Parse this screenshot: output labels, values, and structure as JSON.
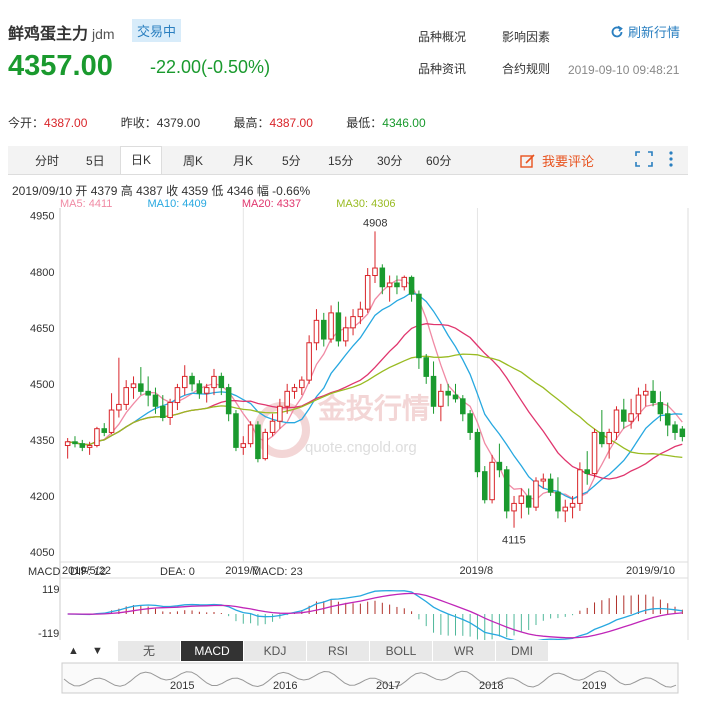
{
  "header": {
    "name": "鲜鸡蛋主力",
    "code": "jdm",
    "status": "交易中",
    "price": "4357.00",
    "change": "-22.00(-0.50%)",
    "links": [
      "品种概况",
      "影响因素",
      "品种资讯",
      "合约规则"
    ],
    "refresh": "刷新行情",
    "timestamp": "2019-09-10 09:48:21"
  },
  "stats": {
    "open_label": "今开：",
    "open": "4387.00",
    "prev_label": "昨收：",
    "prev": "4379.00",
    "high_label": "最高：",
    "high": "4387.00",
    "low_label": "最低：",
    "low": "4346.00"
  },
  "tabs": [
    "分时",
    "5日",
    "日K",
    "周K",
    "月K",
    "5分",
    "15分",
    "30分",
    "60分"
  ],
  "active_tab": "日K",
  "review": "我要评论",
  "ohlc_line": "2019/09/10  开 4379  高 4387  收 4359  低 4346  幅 -0.66%",
  "ma": [
    {
      "label": "MA5: 4411",
      "color": "#f08aa4"
    },
    {
      "label": "MA10: 4409",
      "color": "#27a8e0"
    },
    {
      "label": "MA20: 4337",
      "color": "#e0366e"
    },
    {
      "label": "MA30: 4306",
      "color": "#99bb22"
    }
  ],
  "macd_line": {
    "title": "MACD",
    "dif": "DIF: 12",
    "dea": "DEA: 0",
    "macd": "MACD: 23"
  },
  "indicator_buttons": [
    "无",
    "MACD",
    "KDJ",
    "RSI",
    "BOLL",
    "WR",
    "DMI"
  ],
  "active_indicator": "MACD",
  "nav_years": [
    "2015",
    "2016",
    "2017",
    "2018",
    "2019"
  ],
  "watermark": {
    "brand": "金投行情",
    "url": "quote.cngold.org"
  },
  "colors": {
    "up": "#d9252a",
    "down": "#1a9a2e",
    "accent": "#2a7fc0"
  },
  "chart_data": {
    "type": "candlestick",
    "title": "",
    "price_axis": {
      "ticks": [
        4950,
        4800,
        4650,
        4500,
        4350,
        4200,
        4050
      ],
      "ylim": [
        4050,
        4960
      ]
    },
    "date_labels": [
      "2019/5/22",
      "2019/7",
      "2019/8",
      "2019/9/10"
    ],
    "annotations": {
      "max": 4908,
      "min": 4115
    },
    "candles": [
      [
        4335,
        4355,
        4300,
        4345
      ],
      [
        4345,
        4360,
        4330,
        4340
      ],
      [
        4340,
        4350,
        4320,
        4330
      ],
      [
        4330,
        4345,
        4310,
        4335
      ],
      [
        4335,
        4385,
        4330,
        4380
      ],
      [
        4380,
        4395,
        4360,
        4370
      ],
      [
        4370,
        4475,
        4365,
        4430
      ],
      [
        4430,
        4570,
        4410,
        4445
      ],
      [
        4445,
        4510,
        4430,
        4490
      ],
      [
        4490,
        4520,
        4460,
        4500
      ],
      [
        4500,
        4545,
        4470,
        4480
      ],
      [
        4480,
        4520,
        4440,
        4470
      ],
      [
        4470,
        4490,
        4420,
        4440
      ],
      [
        4440,
        4470,
        4400,
        4410
      ],
      [
        4410,
        4460,
        4390,
        4450
      ],
      [
        4450,
        4500,
        4430,
        4490
      ],
      [
        4490,
        4550,
        4470,
        4520
      ],
      [
        4520,
        4530,
        4480,
        4500
      ],
      [
        4500,
        4510,
        4460,
        4475
      ],
      [
        4475,
        4500,
        4450,
        4490
      ],
      [
        4490,
        4540,
        4470,
        4520
      ],
      [
        4520,
        4530,
        4470,
        4490
      ],
      [
        4490,
        4500,
        4400,
        4420
      ],
      [
        4420,
        4430,
        4320,
        4330
      ],
      [
        4330,
        4360,
        4310,
        4340
      ],
      [
        4340,
        4400,
        4330,
        4390
      ],
      [
        4390,
        4400,
        4290,
        4300
      ],
      [
        4300,
        4380,
        4295,
        4370
      ],
      [
        4370,
        4420,
        4360,
        4400
      ],
      [
        4400,
        4460,
        4380,
        4440
      ],
      [
        4440,
        4500,
        4420,
        4480
      ],
      [
        4480,
        4500,
        4460,
        4490
      ],
      [
        4490,
        4520,
        4470,
        4510
      ],
      [
        4510,
        4630,
        4500,
        4610
      ],
      [
        4610,
        4700,
        4590,
        4670
      ],
      [
        4670,
        4690,
        4600,
        4620
      ],
      [
        4620,
        4710,
        4610,
        4690
      ],
      [
        4690,
        4720,
        4600,
        4615
      ],
      [
        4615,
        4680,
        4600,
        4650
      ],
      [
        4650,
        4700,
        4630,
        4680
      ],
      [
        4680,
        4720,
        4660,
        4700
      ],
      [
        4700,
        4810,
        4690,
        4790
      ],
      [
        4790,
        4908,
        4770,
        4810
      ],
      [
        4810,
        4820,
        4740,
        4760
      ],
      [
        4760,
        4790,
        4720,
        4770
      ],
      [
        4770,
        4790,
        4740,
        4760
      ],
      [
        4760,
        4790,
        4750,
        4785
      ],
      [
        4785,
        4790,
        4720,
        4740
      ],
      [
        4740,
        4750,
        4540,
        4570
      ],
      [
        4570,
        4580,
        4500,
        4520
      ],
      [
        4520,
        4560,
        4420,
        4440
      ],
      [
        4440,
        4500,
        4400,
        4480
      ],
      [
        4480,
        4500,
        4440,
        4470
      ],
      [
        4470,
        4500,
        4450,
        4460
      ],
      [
        4460,
        4470,
        4400,
        4420
      ],
      [
        4420,
        4430,
        4350,
        4370
      ],
      [
        4370,
        4380,
        4250,
        4265
      ],
      [
        4265,
        4280,
        4180,
        4190
      ],
      [
        4190,
        4310,
        4180,
        4290
      ],
      [
        4290,
        4340,
        4250,
        4270
      ],
      [
        4270,
        4280,
        4140,
        4160
      ],
      [
        4160,
        4200,
        4115,
        4180
      ],
      [
        4180,
        4220,
        4140,
        4200
      ],
      [
        4200,
        4220,
        4150,
        4170
      ],
      [
        4170,
        4250,
        4160,
        4240
      ],
      [
        4240,
        4260,
        4220,
        4245
      ],
      [
        4245,
        4260,
        4200,
        4210
      ],
      [
        4210,
        4250,
        4140,
        4160
      ],
      [
        4160,
        4190,
        4130,
        4170
      ],
      [
        4170,
        4200,
        4140,
        4180
      ],
      [
        4180,
        4290,
        4160,
        4270
      ],
      [
        4270,
        4320,
        4230,
        4260
      ],
      [
        4260,
        4380,
        4250,
        4370
      ],
      [
        4370,
        4430,
        4330,
        4340
      ],
      [
        4340,
        4380,
        4300,
        4370
      ],
      [
        4370,
        4440,
        4350,
        4430
      ],
      [
        4430,
        4460,
        4380,
        4400
      ],
      [
        4400,
        4460,
        4380,
        4420
      ],
      [
        4420,
        4490,
        4400,
        4470
      ],
      [
        4470,
        4500,
        4440,
        4480
      ],
      [
        4480,
        4510,
        4440,
        4450
      ],
      [
        4450,
        4480,
        4400,
        4420
      ],
      [
        4420,
        4450,
        4360,
        4390
      ],
      [
        4390,
        4400,
        4350,
        4370
      ],
      [
        4379,
        4387,
        4346,
        4359
      ]
    ]
  }
}
